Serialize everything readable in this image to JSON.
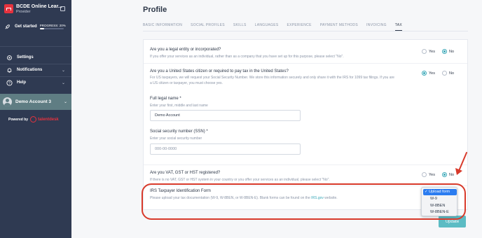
{
  "sidebar": {
    "org_name": "BCDE Online Lear...",
    "org_role": "Provider",
    "get_started": "Get started",
    "progress_text": "PROGRESS: 20%",
    "progress_value": 0.2,
    "items": [
      {
        "label": "Settings"
      },
      {
        "label": "Notifications"
      },
      {
        "label": "Help"
      }
    ],
    "account_name": "Demo Account 3",
    "powered_by": "Powered by",
    "powered_brand": "talentdesk"
  },
  "page": {
    "title": "Profile",
    "tabs": [
      "BASIC INFORMATION",
      "SOCIAL PROFILES",
      "SKILLS",
      "LANGUAGES",
      "EXPERIENCE",
      "PAYMENT METHODS",
      "INVOICING",
      "TAX"
    ],
    "active_tab": "TAX"
  },
  "form": {
    "q1": {
      "question": "Are you a legal entity or incorporated?",
      "help": "If you offer your services as an individual, rather than as a company that you have set up for this purpose, please select \"No\".",
      "yes": "Yes",
      "no": "No",
      "selected": "No"
    },
    "q2": {
      "question": "Are you a United States citizen or required to pay tax in the United States?",
      "help1": "For US taxpayers, we will request your Social Security Number. We store this information securely and only share it with the IRS for 1099 tax filings. If you are",
      "help2": "a US citizen or taxpayer, you must choose yes.",
      "yes": "Yes",
      "no": "No",
      "selected": "Yes"
    },
    "legal_name": {
      "label": "Full legal name *",
      "help": "Enter your first, middle and last name",
      "value": "Demo Account"
    },
    "ssn": {
      "label": "Social security number (SSN) *",
      "help": "Enter your social security number",
      "placeholder": "000-00-0000"
    },
    "q3": {
      "question": "Are you VAT, GST or HST registered?",
      "help": "If there is no VAT, GST or HST system in your country or you offer your services as an individual, please select \"No\".",
      "yes": "Yes",
      "no": "No",
      "selected": "No"
    },
    "irs": {
      "label": "IRS Taxpayer Identification Form",
      "help_before": "Please upload your tax documentation (W-9, W-8BEN, or W-8BEN-E). Blank forms can be found on the ",
      "link": "IRS.gov",
      "help_after": " website."
    },
    "update_label": "Update"
  },
  "dropdown": {
    "options": [
      "Upload form",
      "W-9",
      "W-8BEN",
      "W-8BEN-E"
    ],
    "selected": "Upload form",
    "check": "✓"
  },
  "colors": {
    "sidebar_bg": "#2f3a52",
    "accent": "#3aa8b8",
    "brand_red": "#e6323e",
    "annotation_red": "#d83a2b",
    "select_blue": "#2b7cf0"
  }
}
